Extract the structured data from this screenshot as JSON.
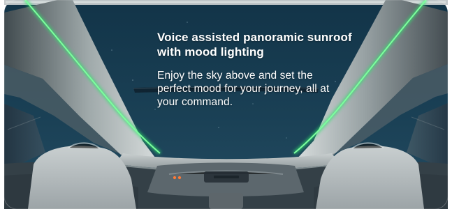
{
  "feature_card": {
    "headline_line1": "Voice assisted panoramic sunroof",
    "headline_line2": "with mood lighting",
    "body": "Enjoy the sky above and set the perfect mood for your journey, all at your command."
  },
  "theme": {
    "sky": "#18384c",
    "accent_light": "#2ee36d",
    "trim": "#c9cfcf"
  }
}
